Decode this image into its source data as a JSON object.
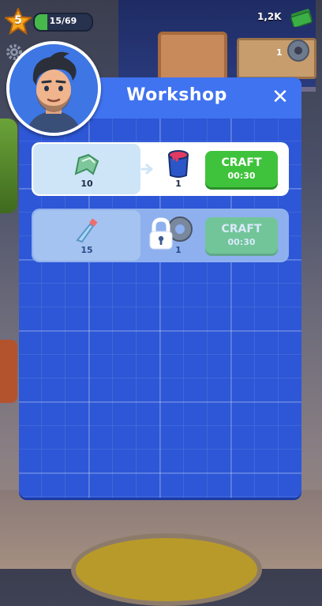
{
  "hud": {
    "level": "5",
    "xp_text": "15/69",
    "xp_progress": 0.217,
    "money": "1,2K",
    "tape_count": "1"
  },
  "panel": {
    "title": "Workshop",
    "close_glyph": "✕"
  },
  "recipes": [
    {
      "ingredient_icon": "fabric-scraps-icon",
      "ingredient_count": "10",
      "output_icon": "paint-bucket-icon",
      "output_count": "1",
      "craft_label": "CRAFT",
      "craft_time": "00:30",
      "locked": false
    },
    {
      "ingredient_icon": "plastic-bottle-icon",
      "ingredient_count": "15",
      "output_icon": "duct-tape-icon",
      "output_count": "1",
      "craft_label": "CRAFT",
      "craft_time": "00:30",
      "locked": true
    }
  ],
  "colors": {
    "panel": "#2f57d9",
    "header": "#4073ef",
    "craft_green": "#3fc33c",
    "xp_green": "#47b84a",
    "level_star": "#f2a51a"
  }
}
